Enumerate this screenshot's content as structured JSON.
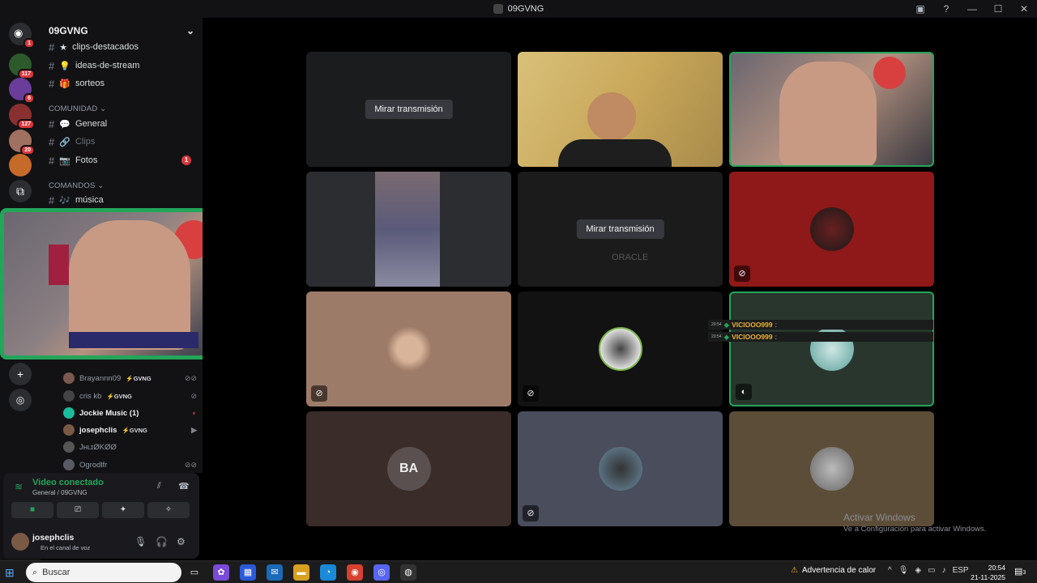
{
  "title": "09GVNG",
  "titlebar_icons": [
    "inbox-icon",
    "help-icon",
    "minimize-icon",
    "maximize-icon",
    "close-icon"
  ],
  "guilds": [
    {
      "badge": "1"
    },
    {
      "badge": "117"
    },
    {
      "badge": "6"
    },
    {
      "badge": "127"
    },
    {
      "badge": "20"
    },
    {
      "badge": ""
    },
    {
      "badge": ""
    }
  ],
  "server": {
    "name": "09GVNG"
  },
  "channels_top": [
    {
      "icon": "★",
      "name": "clips-destacados"
    },
    {
      "icon": "💡",
      "name": "ideas-de-stream"
    },
    {
      "icon": "🎁",
      "name": "sorteos"
    }
  ],
  "cat_comunidad": "COMUNIDAD",
  "channels_com": [
    {
      "icon": "💬",
      "name": "General",
      "muted": false
    },
    {
      "icon": "🔗",
      "name": "Clips",
      "muted": true
    },
    {
      "icon": "📷",
      "name": "Fotos",
      "badge": "1"
    }
  ],
  "cat_comandos": "COMANDOS",
  "channel_musica": {
    "icon": "🎶",
    "name": "música"
  },
  "voice_users": [
    {
      "name": "Brayannn09",
      "tag": "⚡GVNG"
    },
    {
      "name": "cris kb",
      "tag": "⚡GVNG"
    },
    {
      "name": "Jockie Music (1)",
      "tag": ""
    },
    {
      "name": "josephclis",
      "tag": "⚡GVNG"
    },
    {
      "name": "JʜʟɪØKØØ",
      "tag": ""
    },
    {
      "name": "Ogrodlfr",
      "tag": ""
    }
  ],
  "voice": {
    "status": "Video conectado",
    "channel": "General / 09GVNG"
  },
  "user": {
    "name": "josephclis",
    "status": "En el canal de voz"
  },
  "watch_label": "Mirar transmisión",
  "chat": [
    {
      "time": "20:54",
      "name": "VICIOOO999",
      "sep": ":"
    },
    {
      "time": "20:54",
      "name": "VICIOOO999",
      "sep": ":"
    }
  ],
  "tile_texts": {
    "oracle": "ORACLE",
    "avatar_ba": "BA"
  },
  "activate": {
    "line1": "Activar Windows",
    "line2": "Ve a Configuración para activar Windows."
  },
  "taskbar": {
    "search": "Buscar",
    "heat": "Advertencia de calor",
    "lang": "ESP",
    "time": "20:54",
    "date": "21-11-2025",
    "notif": "3"
  },
  "colors": {
    "accent_green": "#23a55a",
    "badge_red": "#da373c",
    "bg": "#121214"
  }
}
